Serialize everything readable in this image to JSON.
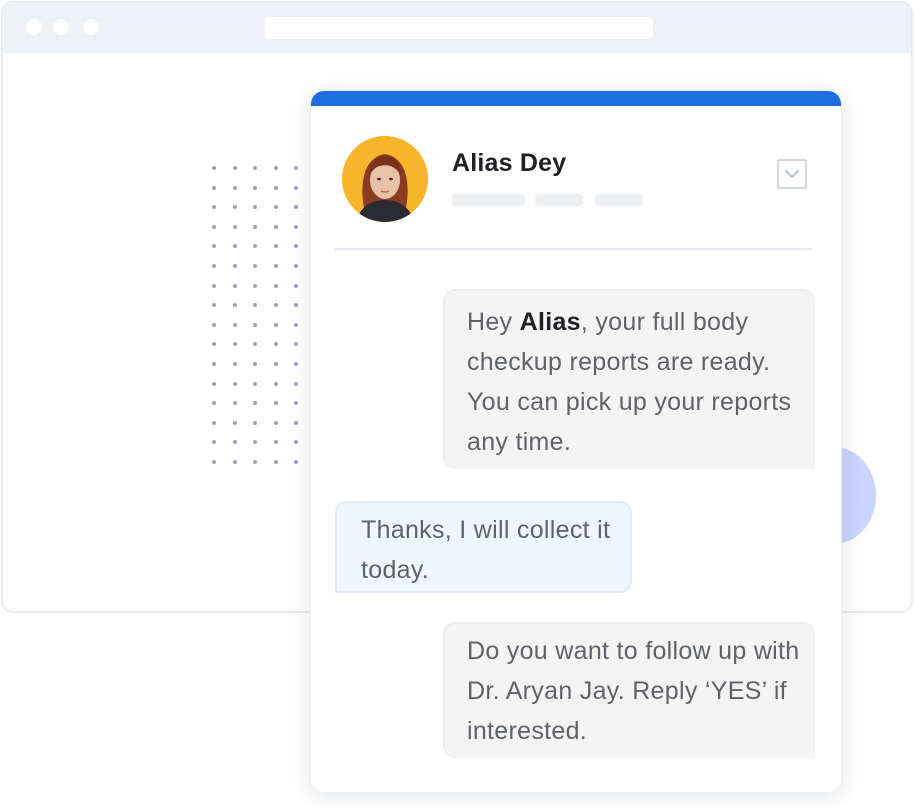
{
  "browser": {
    "window_dots": 3,
    "address_bar": ""
  },
  "chat": {
    "accent_color": "#1f6fe3",
    "contact": {
      "name": "Alias Dey",
      "avatar_icon": "profile-photo"
    },
    "dropdown_icon": "chevron-down-icon",
    "messages": [
      {
        "direction": "incoming",
        "pre": "Hey ",
        "bold": "Alias",
        "post": ", your full body checkup reports are ready. You can pick up your reports any time."
      },
      {
        "direction": "outgoing",
        "text": "Thanks, I will collect it today."
      },
      {
        "direction": "incoming",
        "text": "Do you want to follow up with Dr. Aryan Jay. Reply ‘YES’ if interested."
      }
    ]
  },
  "decor": {
    "dot_grid_color": "#a29fbd",
    "blob_color": "#c9d5fd"
  }
}
